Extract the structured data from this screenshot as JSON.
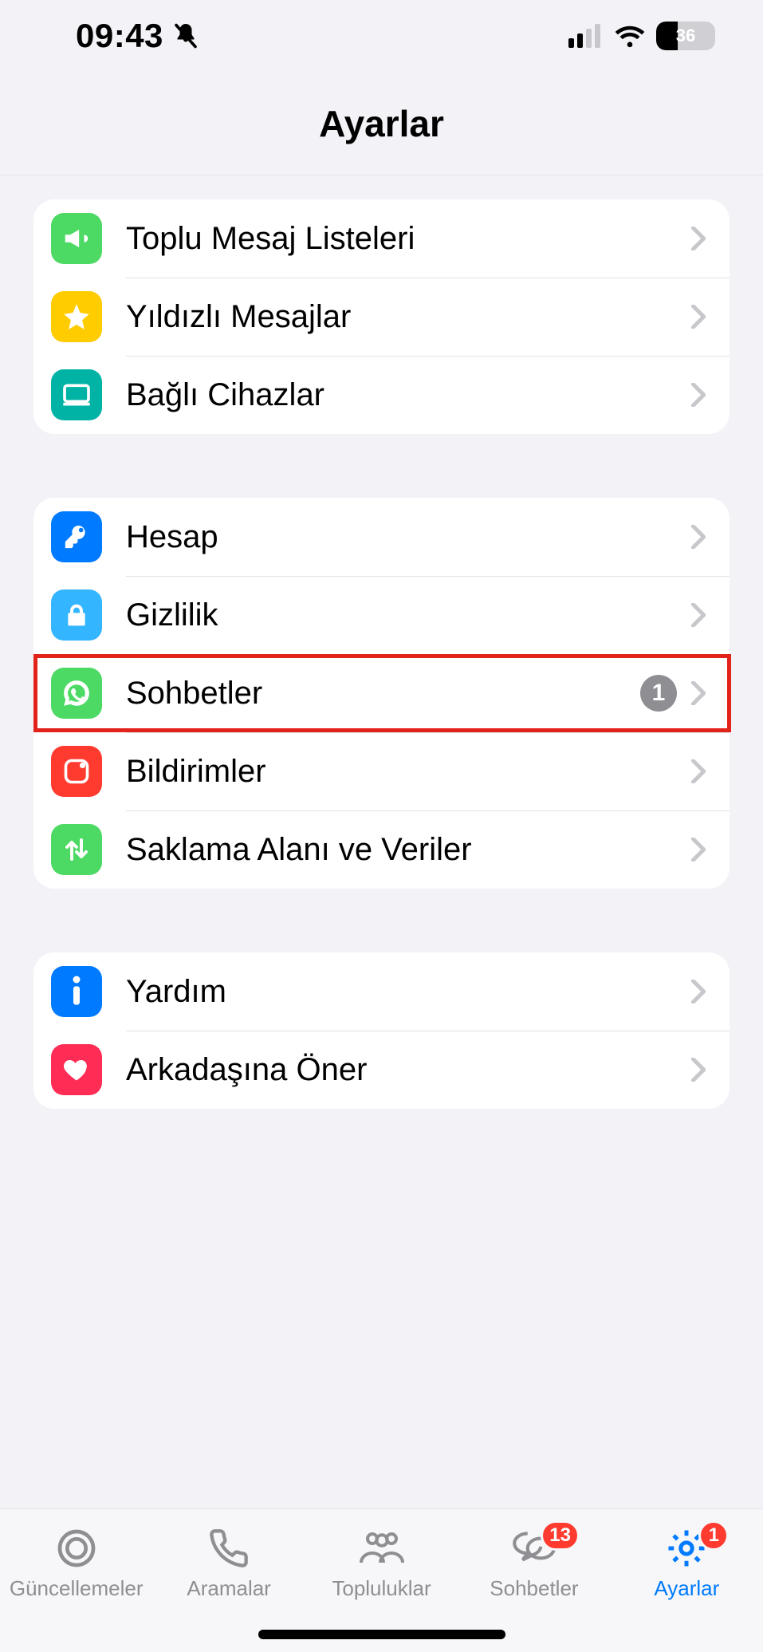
{
  "status": {
    "time": "09:43",
    "battery_percent": "36"
  },
  "nav": {
    "title": "Ayarlar"
  },
  "groups": [
    {
      "rows": [
        {
          "id": "broadcast",
          "label": "Toplu Mesaj Listeleri",
          "icon": "megaphone-icon",
          "iconColor": "#4cd964"
        },
        {
          "id": "starred",
          "label": "Yıldızlı Mesajlar",
          "icon": "star-icon",
          "iconColor": "#ffcc00"
        },
        {
          "id": "linked-devices",
          "label": "Bağlı Cihazlar",
          "icon": "laptop-icon",
          "iconColor": "#00b3a4"
        }
      ]
    },
    {
      "rows": [
        {
          "id": "account",
          "label": "Hesap",
          "icon": "key-icon",
          "iconColor": "#007aff"
        },
        {
          "id": "privacy",
          "label": "Gizlilik",
          "icon": "lock-icon",
          "iconColor": "#33b5ff"
        },
        {
          "id": "chats",
          "label": "Sohbetler",
          "icon": "whatsapp-icon",
          "iconColor": "#4cd964",
          "badge": "1",
          "highlight": true
        },
        {
          "id": "notifications",
          "label": "Bildirimler",
          "icon": "notification-icon",
          "iconColor": "#ff3b30"
        },
        {
          "id": "storage",
          "label": "Saklama Alanı ve Veriler",
          "icon": "updown-icon",
          "iconColor": "#4cd964"
        }
      ]
    },
    {
      "rows": [
        {
          "id": "help",
          "label": "Yardım",
          "icon": "info-icon",
          "iconColor": "#007aff"
        },
        {
          "id": "tell-a-friend",
          "label": "Arkadaşına Öner",
          "icon": "heart-icon",
          "iconColor": "#ff2d55"
        }
      ]
    }
  ],
  "tabs": [
    {
      "id": "updates",
      "label": "Güncellemeler",
      "icon": "status-icon"
    },
    {
      "id": "calls",
      "label": "Aramalar",
      "icon": "phone-icon"
    },
    {
      "id": "communities",
      "label": "Topluluklar",
      "icon": "community-icon"
    },
    {
      "id": "chats-tab",
      "label": "Sohbetler",
      "icon": "chat-icon",
      "badge": "13"
    },
    {
      "id": "settings",
      "label": "Ayarlar",
      "icon": "gear-icon",
      "badge": "1",
      "active": true
    }
  ]
}
